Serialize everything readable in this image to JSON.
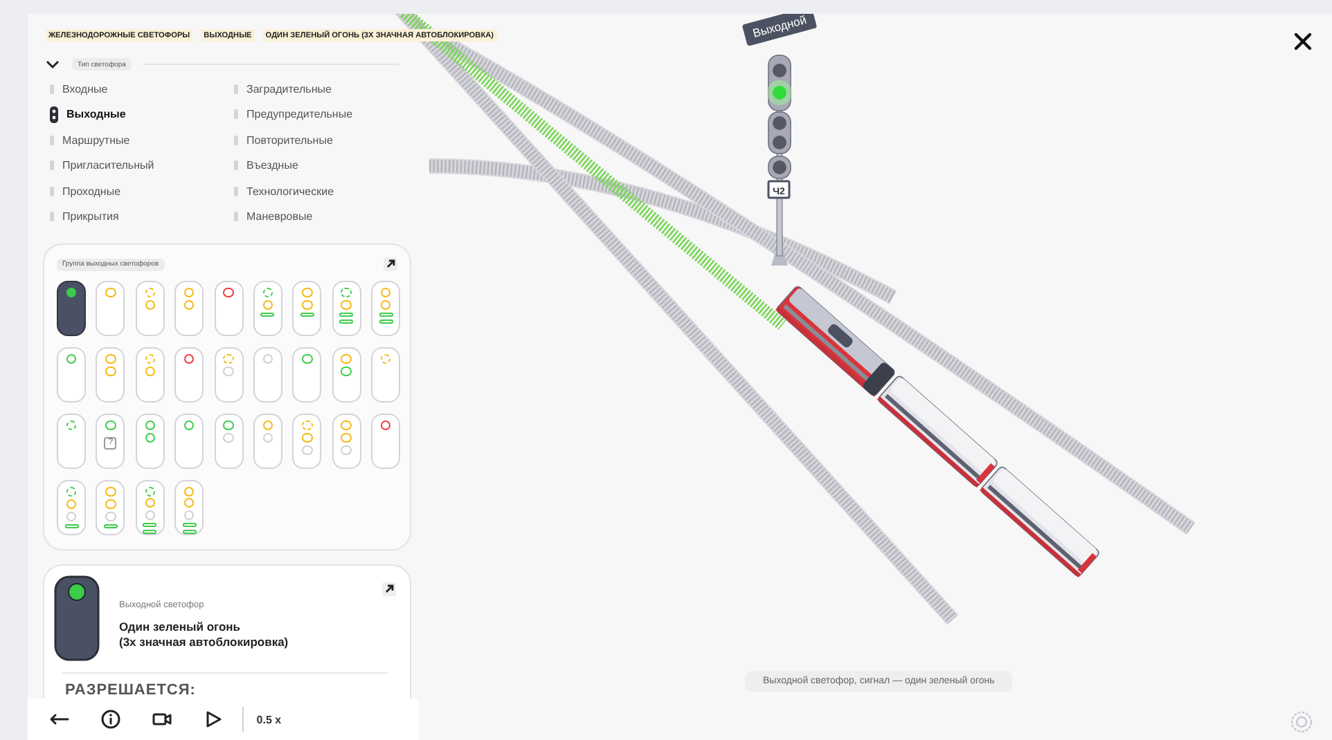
{
  "breadcrumbs": [
    "ЖЕЛЕЗНОДОРОЖНЫЕ СВЕТОФОРЫ",
    "ВЫХОДНЫЕ",
    "ОДИН ЗЕЛЕНЫЙ ОГОНЬ (3Х ЗНАЧНАЯ АВТОБЛОКИРОВКА)"
  ],
  "type_filter": {
    "label": "Тип светофора",
    "expanded": true
  },
  "signal_type_columns": [
    [
      {
        "label": "Входные",
        "selected": false
      },
      {
        "label": "Выходные",
        "selected": true
      },
      {
        "label": "Маршрутные",
        "selected": false
      },
      {
        "label": "Пригласительный",
        "selected": false
      },
      {
        "label": "Проходные",
        "selected": false
      },
      {
        "label": "Прикрытия",
        "selected": false
      }
    ],
    [
      {
        "label": "Заградительные",
        "selected": false
      },
      {
        "label": "Предупредительные",
        "selected": false
      },
      {
        "label": "Повторительные",
        "selected": false
      },
      {
        "label": "Въездные",
        "selected": false
      },
      {
        "label": "Технологические",
        "selected": false
      },
      {
        "label": "Маневровые",
        "selected": false
      }
    ]
  ],
  "group": {
    "title": "Группа выходных светофоров",
    "signals": [
      {
        "selected": true,
        "lamps": [
          {
            "kind": "lamp",
            "color": "#3dcc4a",
            "flashing": false
          }
        ]
      },
      {
        "selected": false,
        "lamps": [
          {
            "kind": "lamp",
            "color": "#f5b914",
            "flashing": false
          }
        ]
      },
      {
        "selected": false,
        "lamps": [
          {
            "kind": "lamp",
            "color": "#f5b914",
            "flashing": true
          },
          {
            "kind": "lamp",
            "color": "#f5b914",
            "flashing": false
          }
        ]
      },
      {
        "selected": false,
        "lamps": [
          {
            "kind": "lamp",
            "color": "#f5b914",
            "flashing": false
          },
          {
            "kind": "lamp",
            "color": "#f5b914",
            "flashing": false
          }
        ]
      },
      {
        "selected": false,
        "lamps": [
          {
            "kind": "lamp",
            "color": "#ec3b45",
            "flashing": false
          }
        ]
      },
      {
        "selected": false,
        "lamps": [
          {
            "kind": "lamp",
            "color": "#3dcc4a",
            "flashing": true
          },
          {
            "kind": "lamp",
            "color": "#f5b914",
            "flashing": false
          },
          {
            "kind": "stripe",
            "color": "#3dcc4a"
          }
        ]
      },
      {
        "selected": false,
        "lamps": [
          {
            "kind": "lamp",
            "color": "#f5b914",
            "flashing": false
          },
          {
            "kind": "lamp",
            "color": "#f5b914",
            "flashing": false
          },
          {
            "kind": "stripe",
            "color": "#3dcc4a"
          }
        ]
      },
      {
        "selected": false,
        "lamps": [
          {
            "kind": "lamp",
            "color": "#3dcc4a",
            "flashing": true
          },
          {
            "kind": "lamp",
            "color": "#f5b914",
            "flashing": false
          },
          {
            "kind": "stripe",
            "color": "#3dcc4a"
          },
          {
            "kind": "stripe",
            "color": "#3dcc4a"
          }
        ]
      },
      {
        "selected": false,
        "lamps": [
          {
            "kind": "lamp",
            "color": "#f5b914",
            "flashing": false
          },
          {
            "kind": "lamp",
            "color": "#f5b914",
            "flashing": false
          },
          {
            "kind": "stripe",
            "color": "#3dcc4a"
          },
          {
            "kind": "stripe",
            "color": "#3dcc4a"
          }
        ]
      },
      {
        "selected": false,
        "lamps": [
          {
            "kind": "lamp",
            "color": "#3dcc4a",
            "flashing": false
          }
        ]
      },
      {
        "selected": false,
        "lamps": [
          {
            "kind": "lamp",
            "color": "#f5b914",
            "flashing": false
          },
          {
            "kind": "lamp",
            "color": "#f5b914",
            "flashing": false
          }
        ]
      },
      {
        "selected": false,
        "lamps": [
          {
            "kind": "lamp",
            "color": "#f5b914",
            "flashing": true
          },
          {
            "kind": "lamp",
            "color": "#f5b914",
            "flashing": false
          }
        ]
      },
      {
        "selected": false,
        "lamps": [
          {
            "kind": "lamp",
            "color": "#ec3b45",
            "flashing": false
          }
        ]
      },
      {
        "selected": false,
        "lamps": [
          {
            "kind": "lamp",
            "color": "#f5b914",
            "flashing": true
          },
          {
            "kind": "lamp",
            "color": "#cfcfd6",
            "flashing": false
          }
        ]
      },
      {
        "selected": false,
        "lamps": [
          {
            "kind": "lamp",
            "color": "#cfcfd6",
            "flashing": false
          }
        ]
      },
      {
        "selected": false,
        "lamps": [
          {
            "kind": "lamp",
            "color": "#3dcc4a",
            "flashing": false
          }
        ]
      },
      {
        "selected": false,
        "lamps": [
          {
            "kind": "lamp",
            "color": "#f5b914",
            "flashing": false
          },
          {
            "kind": "lamp",
            "color": "#3dcc4a",
            "flashing": false
          }
        ]
      },
      {
        "selected": false,
        "lamps": [
          {
            "kind": "lamp",
            "color": "#f5b914",
            "flashing": true
          }
        ]
      },
      {
        "selected": false,
        "lamps": [
          {
            "kind": "lamp",
            "color": "#3dcc4a",
            "flashing": true
          }
        ]
      },
      {
        "selected": false,
        "lamps": [
          {
            "kind": "lamp",
            "color": "#3dcc4a",
            "flashing": false
          },
          {
            "kind": "marker",
            "text": "?"
          }
        ]
      },
      {
        "selected": false,
        "lamps": [
          {
            "kind": "lamp",
            "color": "#3dcc4a",
            "flashing": false
          },
          {
            "kind": "lamp",
            "color": "#3dcc4a",
            "flashing": false
          }
        ]
      },
      {
        "selected": false,
        "lamps": [
          {
            "kind": "lamp",
            "color": "#3dcc4a",
            "flashing": false
          }
        ]
      },
      {
        "selected": false,
        "lamps": [
          {
            "kind": "lamp",
            "color": "#3dcc4a",
            "flashing": false
          },
          {
            "kind": "lamp",
            "color": "#cfcfd6",
            "flashing": false
          }
        ]
      },
      {
        "selected": false,
        "lamps": [
          {
            "kind": "lamp",
            "color": "#f5b914",
            "flashing": false
          },
          {
            "kind": "lamp",
            "color": "#cfcfd6",
            "flashing": false
          }
        ]
      },
      {
        "selected": false,
        "lamps": [
          {
            "kind": "lamp",
            "color": "#f5b914",
            "flashing": true
          },
          {
            "kind": "lamp",
            "color": "#f5b914",
            "flashing": false
          },
          {
            "kind": "lamp",
            "color": "#cfcfd6",
            "flashing": false
          }
        ]
      },
      {
        "selected": false,
        "lamps": [
          {
            "kind": "lamp",
            "color": "#f5b914",
            "flashing": false
          },
          {
            "kind": "lamp",
            "color": "#f5b914",
            "flashing": false
          },
          {
            "kind": "lamp",
            "color": "#cfcfd6",
            "flashing": false
          }
        ]
      },
      {
        "selected": false,
        "lamps": [
          {
            "kind": "lamp",
            "color": "#ec3b45",
            "flashing": false
          }
        ]
      },
      {
        "selected": false,
        "lamps": [
          {
            "kind": "lamp",
            "color": "#3dcc4a",
            "flashing": true
          },
          {
            "kind": "lamp",
            "color": "#f5b914",
            "flashing": false
          },
          {
            "kind": "lamp",
            "color": "#cfcfd6",
            "flashing": false
          },
          {
            "kind": "stripe",
            "color": "#3dcc4a"
          }
        ]
      },
      {
        "selected": false,
        "lamps": [
          {
            "kind": "lamp",
            "color": "#f5b914",
            "flashing": false
          },
          {
            "kind": "lamp",
            "color": "#f5b914",
            "flashing": false
          },
          {
            "kind": "lamp",
            "color": "#cfcfd6",
            "flashing": false
          },
          {
            "kind": "stripe",
            "color": "#3dcc4a"
          }
        ]
      },
      {
        "selected": false,
        "lamps": [
          {
            "kind": "lamp",
            "color": "#3dcc4a",
            "flashing": true
          },
          {
            "kind": "lamp",
            "color": "#f5b914",
            "flashing": false
          },
          {
            "kind": "lamp",
            "color": "#cfcfd6",
            "flashing": false
          },
          {
            "kind": "stripe",
            "color": "#3dcc4a"
          },
          {
            "kind": "stripe",
            "color": "#3dcc4a"
          }
        ]
      },
      {
        "selected": false,
        "lamps": [
          {
            "kind": "lamp",
            "color": "#f5b914",
            "flashing": false
          },
          {
            "kind": "lamp",
            "color": "#f5b914",
            "flashing": false
          },
          {
            "kind": "lamp",
            "color": "#cfcfd6",
            "flashing": false
          },
          {
            "kind": "stripe",
            "color": "#3dcc4a"
          },
          {
            "kind": "stripe",
            "color": "#3dcc4a"
          }
        ]
      }
    ]
  },
  "detail": {
    "category": "Выходной светофор",
    "title": [
      "Один зеленый огонь",
      "(3х значная автоблокировка)"
    ],
    "section": "РАЗРЕШАЕТСЯ:"
  },
  "scene": {
    "sign": "Выходной",
    "plate": "Ч2",
    "caption": "Выходной светофор, сигнал — один зеленый огонь"
  },
  "player": {
    "playing": false,
    "speed": "0.5 x"
  }
}
